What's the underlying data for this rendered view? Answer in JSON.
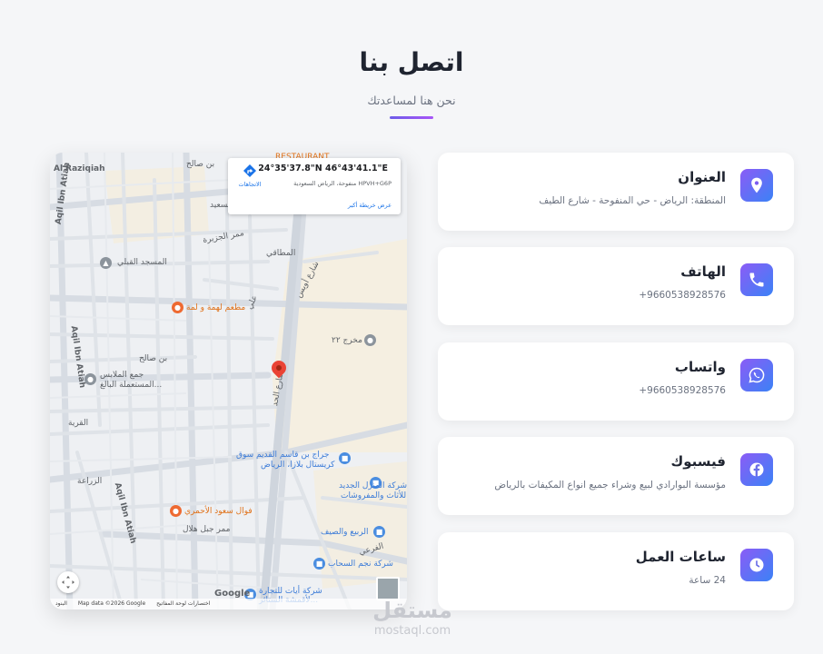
{
  "header": {
    "title": "اتصل بنا",
    "subtitle": "نحن هنا لمساعدتك"
  },
  "map": {
    "info": {
      "coords": "24°35'37.8\"N 46°43'41.1\"E",
      "plus_code": "HPVH+G6P منفوحة، الرياض السعودية",
      "larger_map": "عرض خريطة أكبر",
      "directions": "الاتجاهات"
    },
    "labels": {
      "restaurant": "RESTAURANT",
      "al_raziqiah": "Al Raziqiah",
      "salih": "بن صالح",
      "aqil_ibn_atiah_1": "Aqil Ibn Atiah",
      "al_saeed": "السعيد",
      "al_jazeera": "ممر الجزيرة",
      "al_qebli": "المسجد القبلي",
      "al_mataqi": "المطاقي",
      "owais": "شارع أويس",
      "al_ahad": "شارع الحد",
      "restaurant_2": "مطعم لهمة و لمة",
      "ali": "علي",
      "midrej": "مخرج ٢٢",
      "aqil_ibn_atiah_2": "Aqil Ibn Atiah",
      "clothing_1": "جمع الملابس",
      "clothing_2": "المستعملة البالغ...",
      "bin_salih": "بن صالح",
      "qasim_garage": "جراج بن قاسم القديم سوق",
      "qasim_garage_2": "كريستال بلازا، الرياض",
      "al_qariya": "القرية",
      "furniture_1": "شركة المنزل الجديد",
      "furniture_2": "للأثاث والمفروشات",
      "al_zaraa": "الزراعة",
      "aqil_ibn_atiah_3": "Aqil Ibn Atiah",
      "al_ahmari": "فوال سعود الأحمري",
      "hilal": "ممر جبل هلال",
      "rabie": "الربيع والصيف",
      "najm": "شركة نجم السحاب",
      "ayat_1": "شركة أيات للتجارة",
      "ayat_2": "لأقمشة الستائر...",
      "al_farai": "الفرعي"
    },
    "google_logo": "Google",
    "attribution": [
      "اختصارات لوحة المفاتيح",
      "Map data ©2026 Google",
      "البنود"
    ]
  },
  "cards": [
    {
      "id": "address",
      "title": "العنوان",
      "value": "المنطقة: الرياض - حي المنفوحة - شارع الطيف",
      "icon": "location-pin-icon"
    },
    {
      "id": "phone",
      "title": "الهاتف",
      "value": "+9660538928576",
      "icon": "phone-icon"
    },
    {
      "id": "whatsapp",
      "title": "واتساب",
      "value": "+9660538928576",
      "icon": "whatsapp-icon"
    },
    {
      "id": "facebook",
      "title": "فيسبوك",
      "value": "مؤسسة البوارادي لبيع وشراء جميع انواع المكيفات بالرياض",
      "icon": "facebook-icon"
    },
    {
      "id": "hours",
      "title": "ساعات العمل",
      "value": "24 ساعة",
      "icon": "clock-icon"
    }
  ],
  "watermark": {
    "arabic": "مستقل",
    "latin": "mostaql.com"
  },
  "colors": {
    "accent_start": "#8b5cf6",
    "accent_end": "#3b82f6",
    "map_pin": "#ea4335"
  }
}
